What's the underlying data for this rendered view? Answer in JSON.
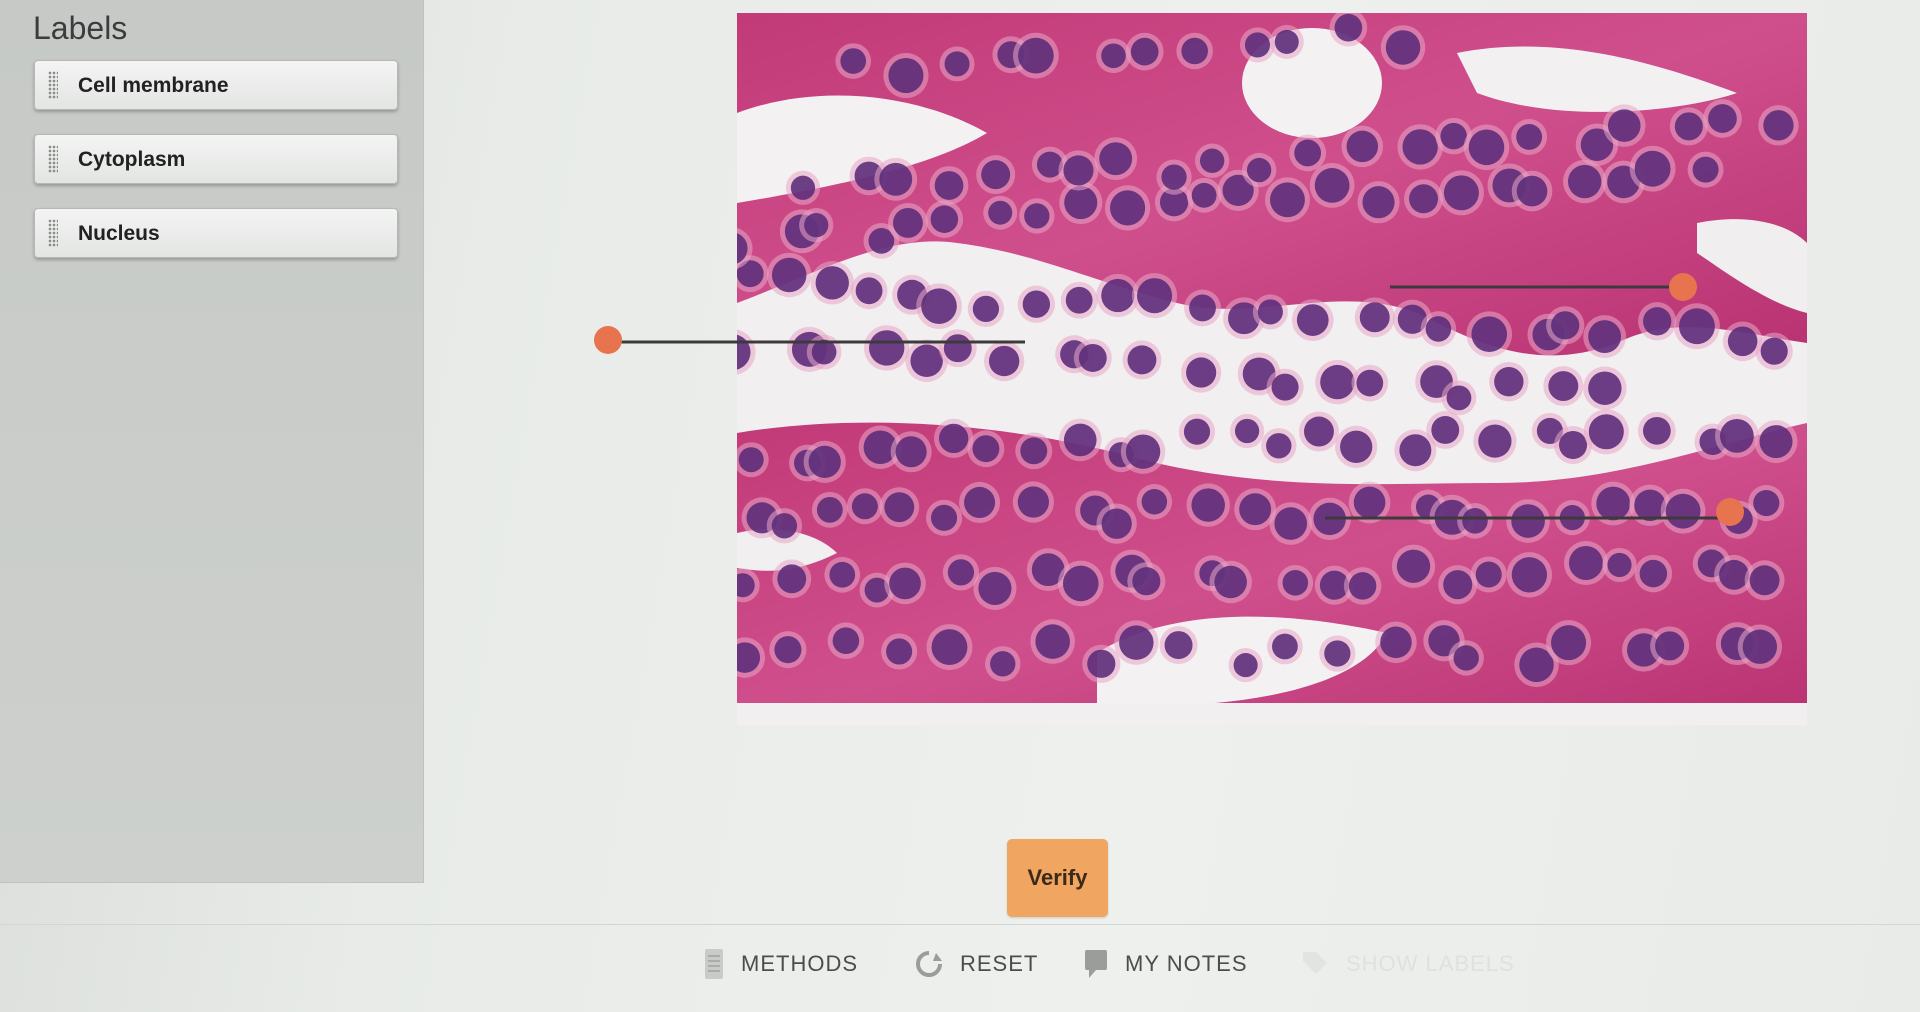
{
  "labels_panel": {
    "title": "Labels",
    "items": [
      {
        "label": "Cell membrane"
      },
      {
        "label": "Cytoplasm"
      },
      {
        "label": "Nucleus"
      }
    ]
  },
  "verify_label": "Verify",
  "toolbar": {
    "methods_label": "METHODS",
    "reset_label": "RESET",
    "notes_label": "MY NOTES",
    "show_labels_label": "SHOW LABELS"
  },
  "colors": {
    "accent": "#f0a560",
    "marker": "#e8734f",
    "panel": "#c9ccc9",
    "tissue": "#c8417e",
    "nucleus": "#5a2a78"
  },
  "icons": {
    "methods": "document-icon",
    "reset": "circular-arrow-icon",
    "notes": "notepad-icon",
    "show_labels": "tag-icon"
  }
}
